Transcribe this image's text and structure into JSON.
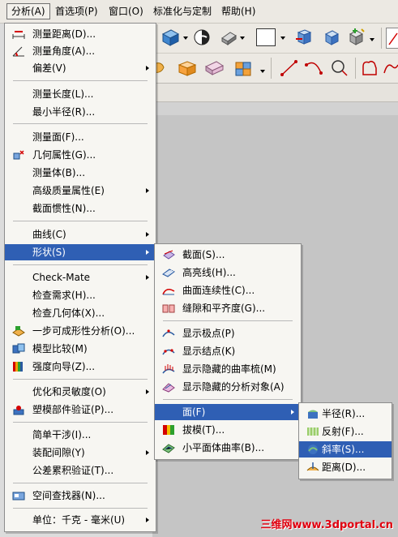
{
  "menubar": {
    "items": [
      {
        "label": "分析(A)"
      },
      {
        "label": "首选项(P)"
      },
      {
        "label": "窗口(O)"
      },
      {
        "label": "标准化与定制"
      },
      {
        "label": "帮助(H)"
      }
    ]
  },
  "analysis_menu": {
    "items": [
      {
        "label": "测量距离(D)..."
      },
      {
        "label": "测量角度(A)..."
      },
      {
        "label": "偏差(V)"
      },
      {
        "label": "测量长度(L)..."
      },
      {
        "label": "最小半径(R)..."
      },
      {
        "label": "测量面(F)..."
      },
      {
        "label": "几何属性(G)..."
      },
      {
        "label": "测量体(B)..."
      },
      {
        "label": "高级质量属性(E)"
      },
      {
        "label": "截面惯性(N)..."
      },
      {
        "label": "曲线(C)"
      },
      {
        "label": "形状(S)"
      },
      {
        "label": "Check-Mate"
      },
      {
        "label": "检查需求(H)..."
      },
      {
        "label": "检查几何体(X)..."
      },
      {
        "label": "一步可成形性分析(O)..."
      },
      {
        "label": "模型比较(M)"
      },
      {
        "label": "强度向导(Z)..."
      },
      {
        "label": "优化和灵敏度(O)"
      },
      {
        "label": "塑模部件验证(P)..."
      },
      {
        "label": "简单干涉(I)..."
      },
      {
        "label": "装配间隙(Y)"
      },
      {
        "label": "公差累积验证(T)..."
      },
      {
        "label": "空间查找器(N)..."
      },
      {
        "label": "单位：千克 - 毫米(U)"
      }
    ]
  },
  "shape_menu": {
    "items": [
      {
        "label": "截面(S)..."
      },
      {
        "label": "高亮线(H)..."
      },
      {
        "label": "曲面连续性(C)..."
      },
      {
        "label": "缝隙和平齐度(G)..."
      },
      {
        "label": "显示极点(P)"
      },
      {
        "label": "显示结点(K)"
      },
      {
        "label": "显示隐藏的曲率梳(M)"
      },
      {
        "label": "显示隐藏的分析对象(A)"
      },
      {
        "label": "面(F)"
      },
      {
        "label": "拔模(T)..."
      },
      {
        "label": "小平面体曲率(B)..."
      }
    ]
  },
  "face_menu": {
    "items": [
      {
        "label": "半径(R)..."
      },
      {
        "label": "反射(F)..."
      },
      {
        "label": "斜率(S)..."
      },
      {
        "label": "距离(D)..."
      }
    ]
  },
  "watermark": {
    "text": "三维网www.3dportal.cn"
  },
  "colors": {
    "highlight": "#2f5fb4",
    "menu_bg": "#f7f6f2",
    "watermark": "#e0000f"
  }
}
